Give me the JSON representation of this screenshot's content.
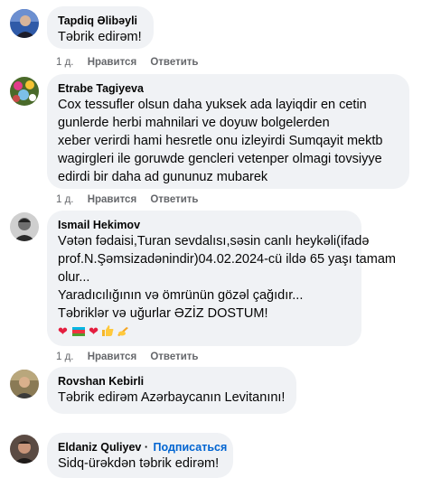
{
  "comments": [
    {
      "author": "Tapdiq Əlibəyli",
      "lines": [
        "Təbrik edirəm!"
      ],
      "time": "1 д.",
      "like": "Нравится",
      "reply": "Ответить"
    },
    {
      "author": "Etrabe Tagiyeva",
      "lines": [
        "Cox tessufler olsun daha yuksek ada layiqdir en cetin",
        "gunlerde herbi mahnilari ve doyuw bolgelerden",
        "xeber verirdi hami hesretle onu izleyirdi Sumqayit mektb",
        "wagirgleri ile goruwde gencleri vetenper olmagi tovsiyye",
        "edirdi bir daha ad gununuz mubarek"
      ],
      "time": "1 д.",
      "like": "Нравится",
      "reply": "Ответить"
    },
    {
      "author": "Ismail Hekimov",
      "lines": [
        "Vətən fədaisi,Turan sevdalısı,səsin canlı heykəli(ifadə",
        "prof.N.Şəmsizadənindir)04.02.2024-cü ildə 65 yaşı tamam",
        "olur...",
        "Yaradıcılığının və ömrünün gözəl çağıdır...",
        "Təbriklər və uğurlar ƏZİZ DOSTUM!"
      ],
      "emojis": [
        "heart",
        "flag-azerbaijan",
        "heart",
        "thumbs-up",
        "writing-hand"
      ],
      "time": "1 д.",
      "like": "Нравится",
      "reply": "Ответить"
    },
    {
      "author": "Rovshan Kebirli",
      "lines": [
        "Təbrik edirəm Azərbaycanın Levitanını!"
      ]
    },
    {
      "author": "Eldaniz Quliyev",
      "dot": "·",
      "follow": "Подписаться",
      "lines": [
        "Sidq-ürəkdən təbrik edirəm!"
      ]
    }
  ],
  "colors": {
    "bubble": "#f0f2f5",
    "meta": "#65676b",
    "link": "#0064d1",
    "heart": "#e41e3f",
    "flag_blue": "#00b5e2",
    "flag_red": "#ef3340",
    "flag_green": "#509e2f"
  }
}
